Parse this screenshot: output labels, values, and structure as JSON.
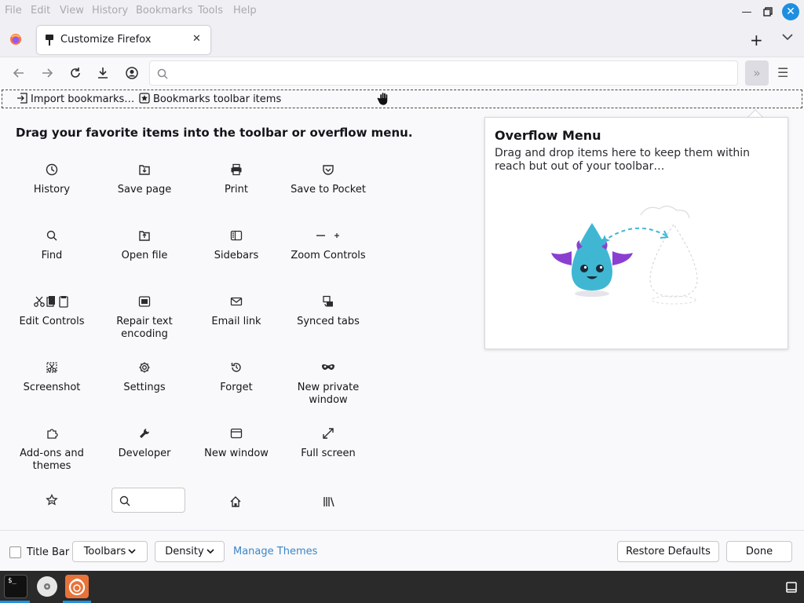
{
  "menubar": {
    "items": [
      "File",
      "Edit",
      "View",
      "History",
      "Bookmarks",
      "Tools",
      "Help"
    ]
  },
  "tab": {
    "title": "Customize Firefox"
  },
  "bookmarks_toolbar": {
    "import_label": "Import bookmarks…",
    "items_label": "Bookmarks toolbar items"
  },
  "customize": {
    "title": "Drag your favorite items into the toolbar or overflow menu.",
    "palette": [
      {
        "label": "History",
        "icon": "clock-icon"
      },
      {
        "label": "Save page",
        "icon": "save-page-icon"
      },
      {
        "label": "Print",
        "icon": "printer-icon"
      },
      {
        "label": "Save to Pocket",
        "icon": "pocket-icon"
      },
      {
        "label": "Find",
        "icon": "magnifier-icon"
      },
      {
        "label": "Open file",
        "icon": "open-file-icon"
      },
      {
        "label": "Sidebars",
        "icon": "sidebar-icon"
      },
      {
        "label": "Zoom Controls",
        "icon": "zoom-icon"
      },
      {
        "label": "Edit Controls",
        "icon": "edit-controls-icon"
      },
      {
        "label": "Repair text encoding",
        "icon": "text-encoding-icon"
      },
      {
        "label": "Email link",
        "icon": "envelope-icon"
      },
      {
        "label": "Synced tabs",
        "icon": "synced-tabs-icon"
      },
      {
        "label": "Screenshot",
        "icon": "screenshot-icon"
      },
      {
        "label": "Settings",
        "icon": "gear-icon"
      },
      {
        "label": "Forget",
        "icon": "forget-icon"
      },
      {
        "label": "New private window",
        "icon": "private-mask-icon"
      },
      {
        "label": "Add-ons and themes",
        "icon": "puzzle-icon"
      },
      {
        "label": "Developer",
        "icon": "wrench-icon"
      },
      {
        "label": "New window",
        "icon": "window-icon"
      },
      {
        "label": "Full screen",
        "icon": "fullscreen-icon"
      }
    ]
  },
  "overflow_menu": {
    "title": "Overflow Menu",
    "description": "Drag and drop items here to keep them within reach but out of your toolbar…"
  },
  "bottom_bar": {
    "title_bar_label": "Title Bar",
    "toolbars_label": "Toolbars",
    "density_label": "Density",
    "manage_themes_label": "Manage Themes",
    "restore_defaults_label": "Restore Defaults",
    "done_label": "Done"
  },
  "colors": {
    "accent": "#1e8fe0",
    "link": "#3a86c8",
    "mascot_body": "#3fb7d3",
    "mascot_wings": "#8a3fd1"
  }
}
